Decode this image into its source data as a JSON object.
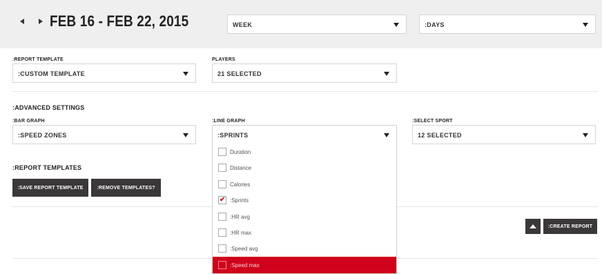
{
  "header": {
    "date_range": "FEB 16 - FEB 22, 2015",
    "period_select": "WEEK",
    "unit_select": ":DAYS"
  },
  "report_template": {
    "label": ":REPORT TEMPLATE",
    "value": ":CUSTOM TEMPLATE"
  },
  "players": {
    "label": "PLAYERS",
    "value": "21 SELECTED"
  },
  "advanced": {
    "title": ":ADVANCED SETTINGS",
    "bar_graph": {
      "label": ":BAR GRAPH",
      "value": ":SPEED ZONES"
    },
    "line_graph": {
      "label": ":LINE GRAPH",
      "value": ":SPRINTS"
    },
    "sport": {
      "label": ":SELECT SPORT",
      "value": "12 SELECTED"
    }
  },
  "report_templates": {
    "title": ":REPORT TEMPLATES",
    "save_label": ":SAVE REPORT TEMPLATE",
    "remove_label": ":REMOVE TEMPLATES?"
  },
  "line_graph_options": [
    {
      "label": "Duration",
      "checked": false,
      "active": false
    },
    {
      "label": "Distance",
      "checked": false,
      "active": false
    },
    {
      "label": "Calories",
      "checked": false,
      "active": false
    },
    {
      "label": ":Sprints",
      "checked": true,
      "active": false
    },
    {
      "label": ":HR avg",
      "checked": false,
      "active": false
    },
    {
      "label": ":HR max",
      "checked": false,
      "active": false
    },
    {
      "label": ":Speed avg",
      "checked": false,
      "active": false
    },
    {
      "label": ":Speed max",
      "checked": false,
      "active": true
    }
  ],
  "create_report_label": ":CREATE REPORT",
  "colors": {
    "accent": "#d0021b",
    "button_dark": "#3a3838",
    "header_bg": "#efefef"
  }
}
